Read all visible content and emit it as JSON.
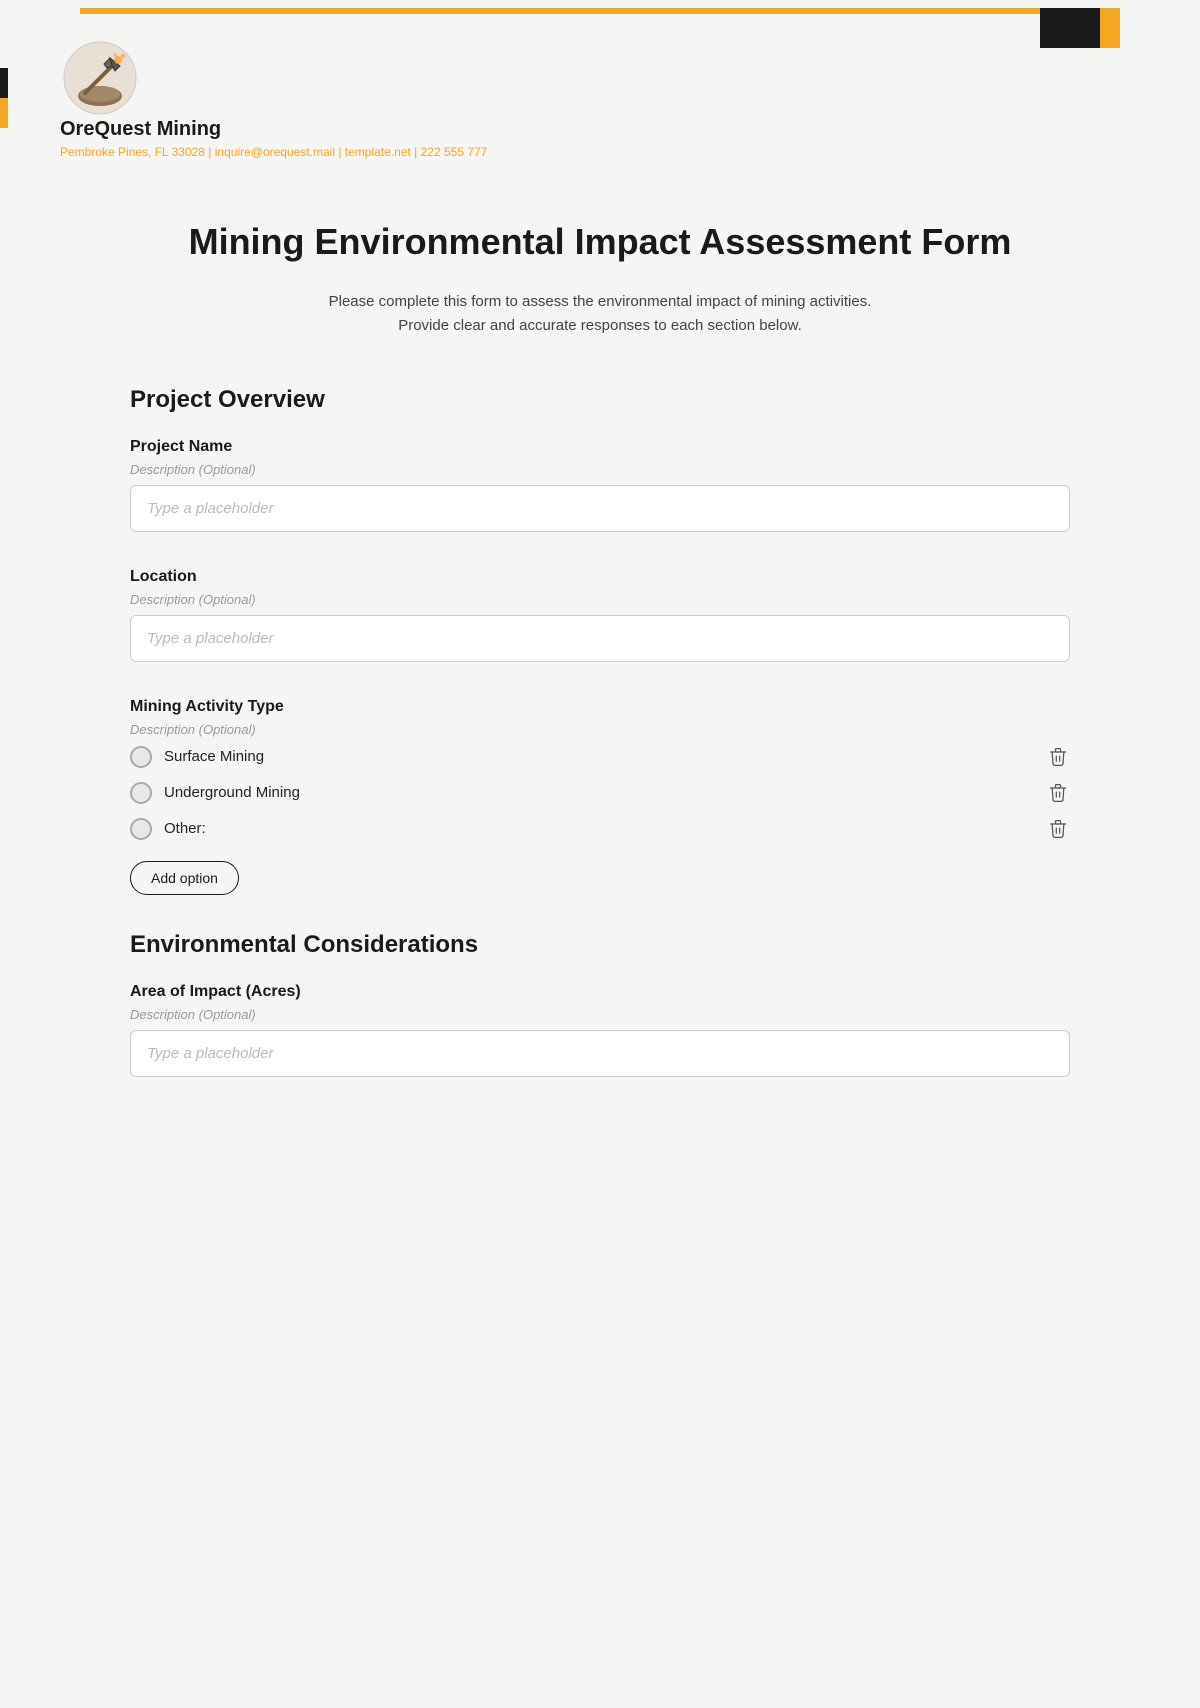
{
  "topBar": {
    "orangeColor": "#f5a623",
    "blackColor": "#1a1a1a"
  },
  "header": {
    "company": {
      "name": "OreQuest Mining",
      "contact": "Pembroke Pines, FL 33028 | inquire@orequest.mail | template.net | 222 555 777"
    }
  },
  "form": {
    "title": "Mining Environmental Impact Assessment Form",
    "description": "Please complete this form to assess the environmental impact of mining activities.\nProvide clear and accurate responses to each section below.",
    "sections": [
      {
        "id": "project-overview",
        "title": "Project Overview",
        "fields": [
          {
            "id": "project-name",
            "label": "Project Name",
            "description": "Description (Optional)",
            "type": "text",
            "placeholder": "Type a placeholder"
          },
          {
            "id": "location",
            "label": "Location",
            "description": "Description (Optional)",
            "type": "text",
            "placeholder": "Type a placeholder"
          },
          {
            "id": "mining-activity-type",
            "label": "Mining Activity Type",
            "description": "Description (Optional)",
            "type": "radio",
            "options": [
              {
                "id": "surface-mining",
                "label": "Surface Mining"
              },
              {
                "id": "underground-mining",
                "label": "Underground Mining"
              },
              {
                "id": "other",
                "label": "Other:"
              }
            ],
            "addOptionLabel": "Add option"
          }
        ]
      },
      {
        "id": "environmental-considerations",
        "title": "Environmental Considerations",
        "fields": [
          {
            "id": "area-of-impact",
            "label": "Area of Impact (Acres)",
            "description": "Description (Optional)",
            "type": "text",
            "placeholder": "Type a placeholder"
          }
        ]
      }
    ]
  }
}
